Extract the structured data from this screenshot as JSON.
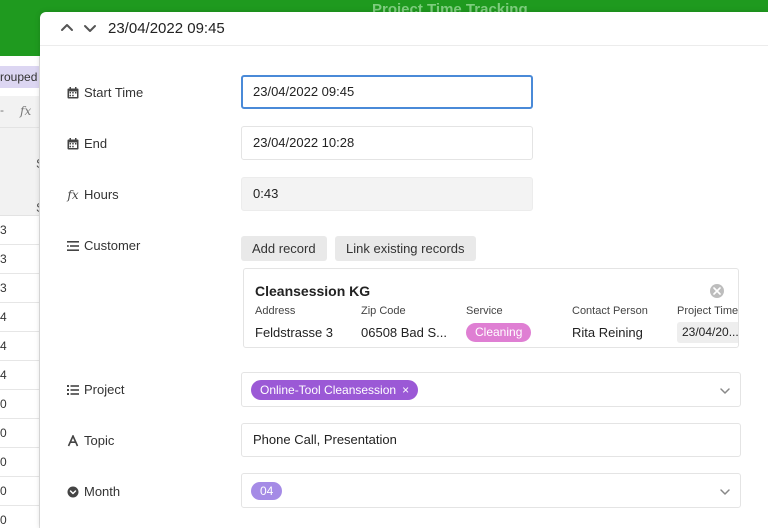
{
  "app": {
    "title": "Project Time Tracking",
    "grouped_label": "rouped",
    "side_header_1": "S",
    "side_header_2": "S",
    "side_rows": [
      "3",
      "3",
      "3",
      "4",
      "4",
      "4",
      "0",
      "0",
      "0",
      "0",
      "0"
    ]
  },
  "record": {
    "title": "23/04/2022 09:45"
  },
  "fields": {
    "start_time": {
      "label": "Start Time",
      "value": "23/04/2022 09:45"
    },
    "end": {
      "label": "End",
      "value": "23/04/2022 10:28"
    },
    "hours": {
      "label": "Hours",
      "value": "0:43"
    },
    "customer": {
      "label": "Customer",
      "add_button": "Add record",
      "link_button": "Link existing records",
      "linked": {
        "name": "Cleansession KG",
        "headers": [
          "Address",
          "Zip Code",
          "Service",
          "Contact Person",
          "Project Time"
        ],
        "address": "Feldstrasse 3",
        "zip": "06508 Bad S...",
        "service": "Cleaning",
        "contact": "Rita Reining",
        "project_time": "23/04/20..."
      }
    },
    "project": {
      "label": "Project",
      "value": "Online-Tool Cleansession",
      "remove_icon": "×"
    },
    "topic": {
      "label": "Topic",
      "value": "Phone Call, Presentation"
    },
    "month": {
      "label": "Month",
      "value": "04"
    }
  },
  "colors": {
    "topbar": "#1f9a1f",
    "focus_border": "#4a8ad8",
    "cleaning_tag": "#df7fd3",
    "project_tag": "#9b59d6",
    "month_tag": "#a58be6"
  }
}
